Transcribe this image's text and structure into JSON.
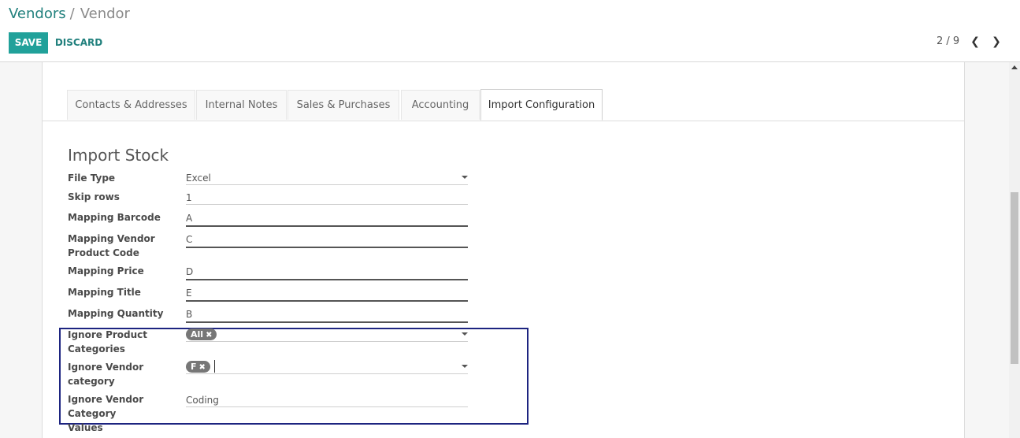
{
  "breadcrumb": {
    "parent": "Vendors",
    "separator": "/",
    "current": "Vendor"
  },
  "toolbar": {
    "save_label": "SAVE",
    "discard_label": "DISCARD"
  },
  "pager": {
    "value": "2 / 9",
    "prev_icon": "chevron-left-icon",
    "next_icon": "chevron-right-icon"
  },
  "tabs": [
    {
      "label": "Contacts & Addresses"
    },
    {
      "label": "Internal Notes"
    },
    {
      "label": "Sales & Purchases"
    },
    {
      "label": "Accounting"
    },
    {
      "label": "Import Configuration",
      "active": true
    }
  ],
  "section": {
    "title": "Import Stock"
  },
  "fields": {
    "file_type": {
      "label": "File Type",
      "value": "Excel"
    },
    "skip_rows": {
      "label": "Skip rows",
      "value": "1"
    },
    "mapping_barcode": {
      "label": "Mapping Barcode",
      "value": "A"
    },
    "mapping_vendor_product_code": {
      "label": "Mapping Vendor Product Code",
      "value": "C"
    },
    "mapping_price": {
      "label": "Mapping Price",
      "value": "D"
    },
    "mapping_title": {
      "label": "Mapping Title",
      "value": "E"
    },
    "mapping_quantity": {
      "label": "Mapping Quantity",
      "value": "B"
    },
    "ignore_product_categories": {
      "label": "Ignore Product Categories",
      "tag": "All"
    },
    "ignore_vendor_category": {
      "label": "Ignore Vendor category",
      "tag": "F"
    },
    "ignore_vendor_category_values": {
      "label": "Ignore Vendor Category Values",
      "value": "Coding"
    }
  },
  "colors": {
    "accent": "#21a19a",
    "link": "#21807d",
    "highlight_border": "#1d2480",
    "tag_bg": "#777777"
  }
}
